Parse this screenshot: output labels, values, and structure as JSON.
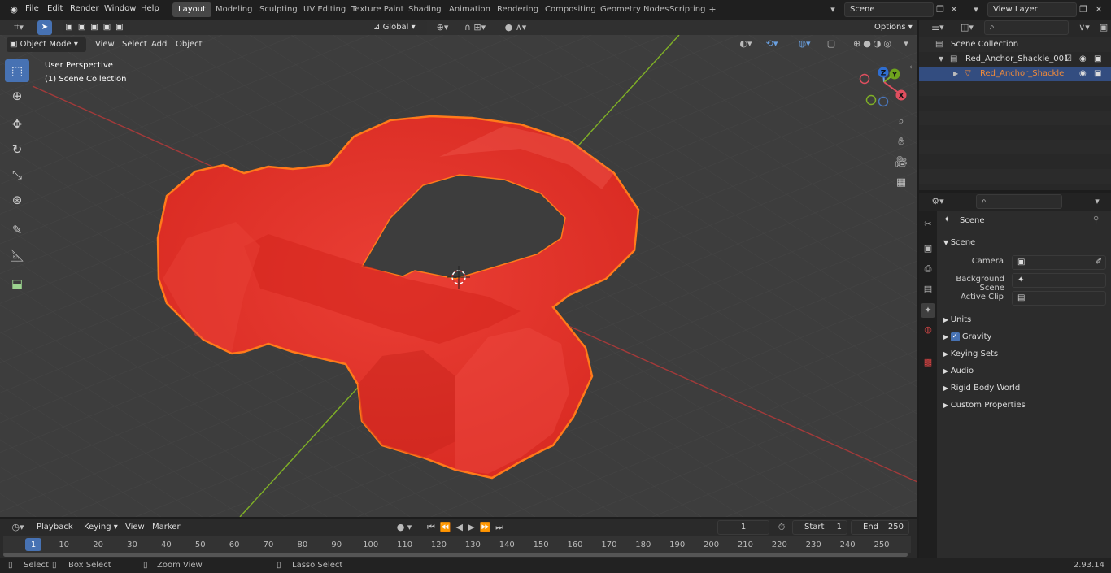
{
  "menus": [
    "File",
    "Edit",
    "Render",
    "Window",
    "Help"
  ],
  "workspaces": [
    "Layout",
    "Modeling",
    "Sculpting",
    "UV Editing",
    "Texture Paint",
    "Shading",
    "Animation",
    "Rendering",
    "Compositing",
    "Geometry Nodes",
    "Scripting"
  ],
  "active_workspace": "Layout",
  "scene_field": "Scene",
  "view_layer_field": "View Layer",
  "viewport": {
    "mode": "Object Mode",
    "menus": [
      "View",
      "Select",
      "Add",
      "Object"
    ],
    "orientation": "Global",
    "options": "Options",
    "overlay_title": "User Perspective",
    "overlay_subtitle": "(1) Scene Collection",
    "gizmo": {
      "z": "Z",
      "y": "Y",
      "x": "X"
    },
    "colors": {
      "bg": "#3d3d3d",
      "grid": "#474747",
      "xaxis": "#a33a3a",
      "yaxis": "#7fb026",
      "object": "#e8332b",
      "outline": "#ff7a1a"
    }
  },
  "outliner": {
    "root": "Scene Collection",
    "items": [
      {
        "label": "Red_Anchor_Shackle_001"
      },
      {
        "label": "Red_Anchor_Shackle"
      }
    ]
  },
  "properties": {
    "header": "Scene",
    "section": "Scene",
    "fields": [
      {
        "label": "Camera"
      },
      {
        "label": "Background Scene"
      },
      {
        "label": "Active Clip"
      }
    ],
    "panels": [
      "Units",
      "Gravity",
      "Keying Sets",
      "Audio",
      "Rigid Body World",
      "Custom Properties"
    ]
  },
  "timeline": {
    "menus": [
      "Playback",
      "Keying",
      "View",
      "Marker"
    ],
    "current_frame": "1",
    "start_label": "Start",
    "start": "1",
    "end_label": "End",
    "end": "250",
    "ticks": [
      "1",
      "10",
      "20",
      "30",
      "40",
      "50",
      "60",
      "70",
      "80",
      "90",
      "100",
      "110",
      "120",
      "130",
      "140",
      "150",
      "160",
      "170",
      "180",
      "190",
      "200",
      "210",
      "220",
      "230",
      "240",
      "250"
    ]
  },
  "status": {
    "select": "Select",
    "box_select": "Box Select",
    "zoom_view": "Zoom View",
    "lasso_select": "Lasso Select",
    "version": "2.93.14"
  }
}
